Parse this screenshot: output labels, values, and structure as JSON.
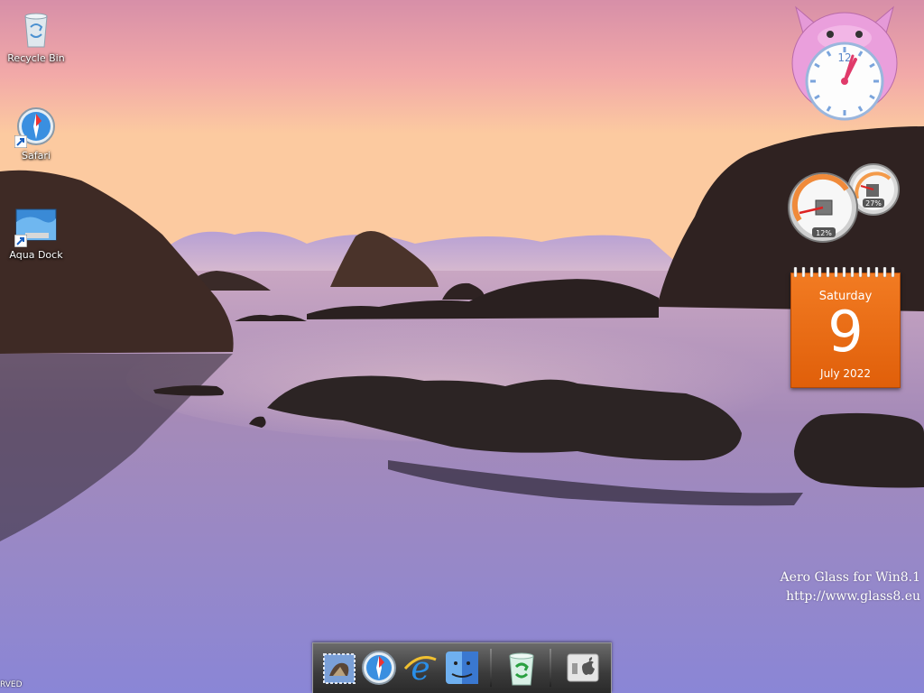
{
  "desktop": {
    "icons": [
      {
        "label": "Recycle Bin",
        "icon": "recycle-bin-icon"
      },
      {
        "label": "Safari",
        "icon": "safari-icon"
      },
      {
        "label": "Aqua Dock",
        "icon": "aqua-dock-icon"
      }
    ]
  },
  "gadgets": {
    "clock": {
      "numeral": "12",
      "hour_hand_angle_deg": 30,
      "minute_hand_angle_deg": 35
    },
    "meters": {
      "cpu_percent": "12%",
      "memory_percent": "27%"
    },
    "calendar": {
      "weekday": "Saturday",
      "day": "9",
      "month_year": "July 2022"
    }
  },
  "watermark": {
    "line1": "Aero Glass for Win8.1",
    "line2": "http://www.glass8.eu"
  },
  "corner_text": "RVED",
  "dock": {
    "items": [
      {
        "name": "mail-icon"
      },
      {
        "name": "safari-icon"
      },
      {
        "name": "internet-explorer-icon"
      },
      {
        "name": "finder-icon"
      },
      {
        "name": "recycle-bin-icon"
      },
      {
        "name": "apple-switch-icon"
      }
    ]
  },
  "colors": {
    "calendar_orange": "#f07a22",
    "sky_top": "#e8a0ae",
    "sky_bottom": "#fbd0a0",
    "water": "#8a78c6"
  }
}
